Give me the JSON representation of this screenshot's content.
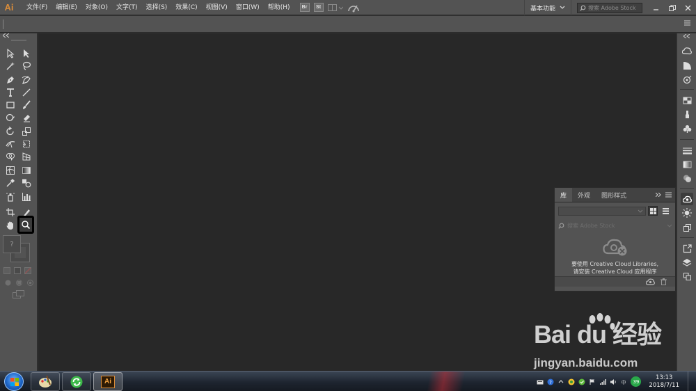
{
  "app": {
    "logo": "Ai"
  },
  "menu": {
    "items": [
      "文件(F)",
      "编辑(E)",
      "对象(O)",
      "文字(T)",
      "选择(S)",
      "效果(C)",
      "视图(V)",
      "窗口(W)",
      "帮助(H)"
    ],
    "bridge_icon": "Br",
    "stock_icon": "St"
  },
  "workspace": {
    "label": "基本功能"
  },
  "search": {
    "placeholder": "搜索 Adobe Stock"
  },
  "libraries_panel": {
    "tabs": [
      "库",
      "外观",
      "图形样式"
    ],
    "active_tab": "库",
    "search_placeholder": "搜索 Adobe Stock",
    "message_line1": "要使用 Creative Cloud Libraries,",
    "message_line2": "请安装 Creative Cloud 应用程序"
  },
  "watermark": {
    "brand": "Bai du 经验",
    "url": "jingyan.baidu.com"
  },
  "taskbar": {
    "ai_button": "Ai",
    "tray_badge": "39",
    "clock_time": "13:13",
    "clock_date": "2018/7/11"
  },
  "colors": {
    "menubar": "#535353",
    "canvas": "#282828",
    "accent": "#d98c3a"
  }
}
